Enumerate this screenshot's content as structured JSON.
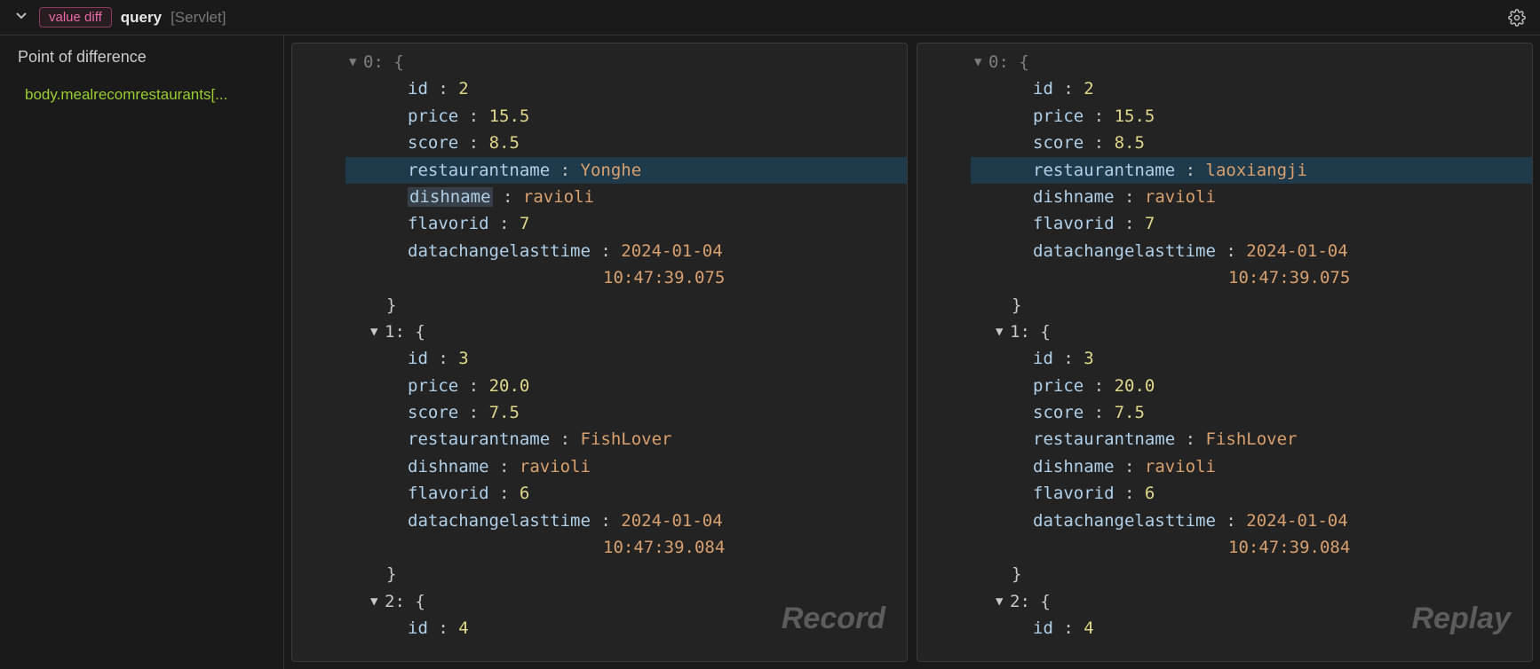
{
  "header": {
    "badge": "value diff",
    "title": "query",
    "subtitle": "[Servlet]"
  },
  "sidebar": {
    "title": "Point of difference",
    "items": [
      "body.mealrecomrestaurants[..."
    ]
  },
  "panes": {
    "left": {
      "watermark": "Record",
      "topIndex": "0",
      "records": [
        {
          "index": "0",
          "partial_top": true,
          "fields": [
            {
              "k": "id",
              "v": "2",
              "t": "num"
            },
            {
              "k": "price",
              "v": "15.5",
              "t": "num"
            },
            {
              "k": "score",
              "v": "8.5",
              "t": "num"
            },
            {
              "k": "restaurantname",
              "v": "Yonghe",
              "t": "str",
              "highlight": true
            },
            {
              "k": "dishname",
              "v": "ravioli",
              "t": "str",
              "keyhighlight": true
            },
            {
              "k": "flavorid",
              "v": "7",
              "t": "num"
            },
            {
              "k": "datachangelasttime",
              "v": "2024-01-04",
              "t": "str",
              "cont": "10:47:39.075"
            }
          ]
        },
        {
          "index": "1",
          "fields": [
            {
              "k": "id",
              "v": "3",
              "t": "num"
            },
            {
              "k": "price",
              "v": "20.0",
              "t": "num"
            },
            {
              "k": "score",
              "v": "7.5",
              "t": "num"
            },
            {
              "k": "restaurantname",
              "v": "FishLover",
              "t": "str"
            },
            {
              "k": "dishname",
              "v": "ravioli",
              "t": "str"
            },
            {
              "k": "flavorid",
              "v": "6",
              "t": "num"
            },
            {
              "k": "datachangelasttime",
              "v": "2024-01-04",
              "t": "str",
              "cont": "10:47:39.084"
            }
          ]
        },
        {
          "index": "2",
          "partial_bottom": true,
          "fields": [
            {
              "k": "id",
              "v": "4",
              "t": "num"
            }
          ]
        }
      ]
    },
    "right": {
      "watermark": "Replay",
      "topIndex": "0",
      "records": [
        {
          "index": "0",
          "partial_top": true,
          "fields": [
            {
              "k": "id",
              "v": "2",
              "t": "num"
            },
            {
              "k": "price",
              "v": "15.5",
              "t": "num"
            },
            {
              "k": "score",
              "v": "8.5",
              "t": "num"
            },
            {
              "k": "restaurantname",
              "v": "laoxiangji",
              "t": "str",
              "highlight": true
            },
            {
              "k": "dishname",
              "v": "ravioli",
              "t": "str"
            },
            {
              "k": "flavorid",
              "v": "7",
              "t": "num"
            },
            {
              "k": "datachangelasttime",
              "v": "2024-01-04",
              "t": "str",
              "cont": "10:47:39.075"
            }
          ]
        },
        {
          "index": "1",
          "fields": [
            {
              "k": "id",
              "v": "3",
              "t": "num"
            },
            {
              "k": "price",
              "v": "20.0",
              "t": "num"
            },
            {
              "k": "score",
              "v": "7.5",
              "t": "num"
            },
            {
              "k": "restaurantname",
              "v": "FishLover",
              "t": "str"
            },
            {
              "k": "dishname",
              "v": "ravioli",
              "t": "str"
            },
            {
              "k": "flavorid",
              "v": "6",
              "t": "num"
            },
            {
              "k": "datachangelasttime",
              "v": "2024-01-04",
              "t": "str",
              "cont": "10:47:39.084"
            }
          ]
        },
        {
          "index": "2",
          "partial_bottom": true,
          "fields": [
            {
              "k": "id",
              "v": "4",
              "t": "num"
            }
          ]
        }
      ]
    }
  }
}
